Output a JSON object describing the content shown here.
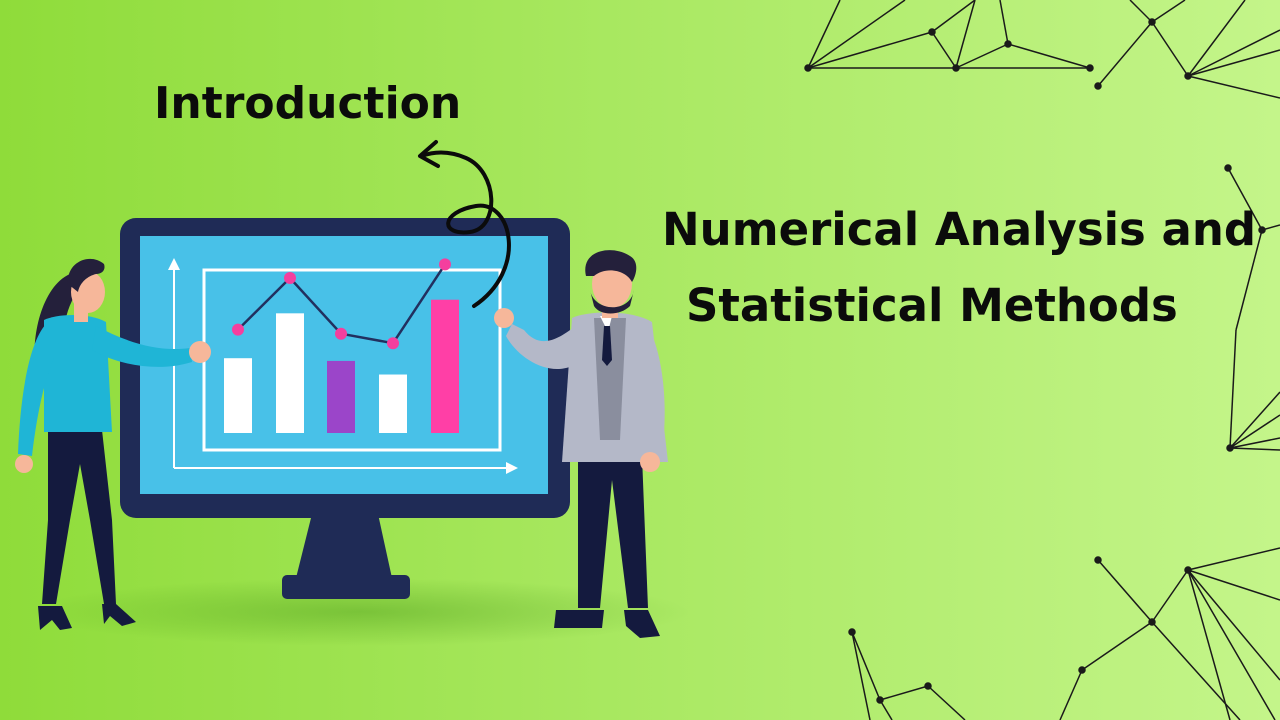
{
  "intro_title": "Introduction",
  "main_title": {
    "line_1": "Numerical Analysis and",
    "line_2": "Statistical Methods"
  },
  "colors": {
    "background_left": "#8fdc3a",
    "background_right": "#c4f58a",
    "monitor_frame": "#1f2b56",
    "monitor_screen": "#48c1e8",
    "bar_white": "#ffffff",
    "bar_purple": "#9b45c9",
    "bar_pink": "#ff3fa6",
    "chart_line": "#22305f",
    "chart_dot": "#f43f9e",
    "woman_top": "#1fb5d6",
    "man_jacket": "#b4b8c8",
    "figure_dark": "#141a3e",
    "skin": "#f6b79a",
    "hair": "#24203b",
    "network_line": "#1a1a1a",
    "title_text": "#0b0b0b"
  },
  "chart_data": {
    "type": "bar",
    "categories": [],
    "values": [
      0.55,
      0.88,
      0.53,
      0.43,
      0.98
    ],
    "line_values": [
      0.76,
      1.14,
      0.73,
      0.66,
      1.24
    ],
    "bar_colors": [
      "#ffffff",
      "#ffffff",
      "#9b45c9",
      "#ffffff",
      "#ff3fa6"
    ],
    "line_color": "#22305f",
    "dot_color": "#f43f9e",
    "title": "",
    "xlabel": "",
    "ylabel": "",
    "ylim": [
      0,
      1.3
    ],
    "grid": false
  }
}
